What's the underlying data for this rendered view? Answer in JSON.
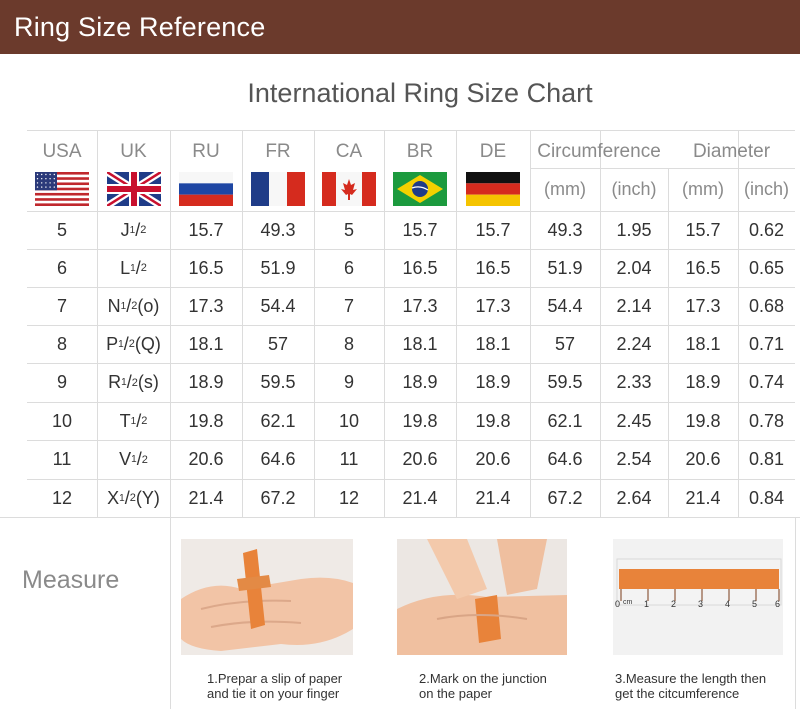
{
  "header": {
    "title": "Ring Size Reference"
  },
  "chart_title": "International Ring Size Chart",
  "columns": [
    "USA",
    "UK",
    "RU",
    "FR",
    "CA",
    "BR",
    "DE",
    "Circumference",
    "Diameter"
  ],
  "units": {
    "circ_mm": "(mm)",
    "circ_inch": "(inch)",
    "dia_mm": "(mm)",
    "dia_inch": "(inch)"
  },
  "flags": [
    "usa-flag-icon",
    "uk-flag-icon",
    "russia-flag-icon",
    "france-flag-icon",
    "canada-flag-icon",
    "brazil-flag-icon",
    "germany-flag-icon"
  ],
  "rows": [
    {
      "usa": "5",
      "uk_letter": "J",
      "uk_alt": "",
      "ru": "15.7",
      "fr": "49.3",
      "ca": "5",
      "br": "15.7",
      "de": "15.7",
      "circ_mm": "49.3",
      "circ_inch": "1.95",
      "dia_mm": "15.7",
      "dia_inch": "0.62"
    },
    {
      "usa": "6",
      "uk_letter": "L",
      "uk_alt": "",
      "ru": "16.5",
      "fr": "51.9",
      "ca": "6",
      "br": "16.5",
      "de": "16.5",
      "circ_mm": "51.9",
      "circ_inch": "2.04",
      "dia_mm": "16.5",
      "dia_inch": "0.65"
    },
    {
      "usa": "7",
      "uk_letter": "N",
      "uk_alt": "(o)",
      "ru": "17.3",
      "fr": "54.4",
      "ca": "7",
      "br": "17.3",
      "de": "17.3",
      "circ_mm": "54.4",
      "circ_inch": "2.14",
      "dia_mm": "17.3",
      "dia_inch": "0.68"
    },
    {
      "usa": "8",
      "uk_letter": "P",
      "uk_alt": "(Q)",
      "ru": "18.1",
      "fr": "57",
      "ca": "8",
      "br": "18.1",
      "de": "18.1",
      "circ_mm": "57",
      "circ_inch": "2.24",
      "dia_mm": "18.1",
      "dia_inch": "0.71"
    },
    {
      "usa": "9",
      "uk_letter": "R",
      "uk_alt": "(s)",
      "ru": "18.9",
      "fr": "59.5",
      "ca": "9",
      "br": "18.9",
      "de": "18.9",
      "circ_mm": "59.5",
      "circ_inch": "2.33",
      "dia_mm": "18.9",
      "dia_inch": "0.74"
    },
    {
      "usa": "10",
      "uk_letter": "T",
      "uk_alt": "",
      "ru": "19.8",
      "fr": "62.1",
      "ca": "10",
      "br": "19.8",
      "de": "19.8",
      "circ_mm": "62.1",
      "circ_inch": "2.45",
      "dia_mm": "19.8",
      "dia_inch": "0.78"
    },
    {
      "usa": "11",
      "uk_letter": "V",
      "uk_alt": "",
      "ru": "20.6",
      "fr": "64.6",
      "ca": "11",
      "br": "20.6",
      "de": "20.6",
      "circ_mm": "64.6",
      "circ_inch": "2.54",
      "dia_mm": "20.6",
      "dia_inch": "0.81"
    },
    {
      "usa": "12",
      "uk_letter": "X",
      "uk_alt": "(Y)",
      "ru": "21.4",
      "fr": "67.2",
      "ca": "12",
      "br": "21.4",
      "de": "21.4",
      "circ_mm": "67.2",
      "circ_inch": "2.64",
      "dia_mm": "21.4",
      "dia_inch": "0.84"
    }
  ],
  "fraction": {
    "num": "1",
    "den": "2"
  },
  "measure": {
    "label": "Measure",
    "steps": [
      {
        "line1": "1.Prepar a slip of paper",
        "line2": "and tie it on your finger"
      },
      {
        "line1": "2.Mark on the junction",
        "line2": "on the paper"
      },
      {
        "line1": "3.Measure the length then",
        "line2": "get the citcumference"
      }
    ],
    "ruler_marks": [
      "0",
      "cm",
      "1",
      "2",
      "3",
      "4",
      "5",
      "6"
    ]
  },
  "colors": {
    "header_bg": "#6b3a2c",
    "grid_line": "#dcdcdc",
    "header_text": "#8a8a8a",
    "paper": "#e8833a"
  }
}
